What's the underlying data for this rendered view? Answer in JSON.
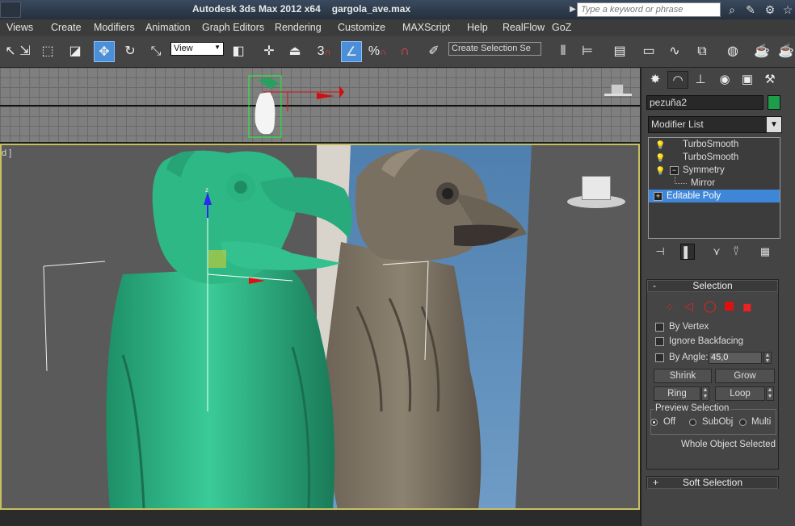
{
  "titlebar": {
    "app_title": "Autodesk 3ds Max  2012 x64",
    "file_name": "gargola_ave.max",
    "search_placeholder": "Type a keyword or phrase"
  },
  "menu": [
    "Views",
    "Create",
    "Modifiers",
    "Animation",
    "Graph Editors",
    "Rendering",
    "Customize",
    "MAXScript",
    "Help",
    "RealFlow",
    "GoZ"
  ],
  "toolbar": {
    "reference_coord": "View",
    "selection_set_placeholder": "Create Selection Se",
    "snap_value": "3",
    "percent_snap": "%"
  },
  "viewport": {
    "label": "d ]"
  },
  "command_panel": {
    "object_name": "pezuña2",
    "object_color": "#1d9c4a",
    "modifier_list_label": "Modifier List",
    "stack": [
      {
        "label": "TurboSmooth",
        "selected": false
      },
      {
        "label": "TurboSmooth",
        "selected": false
      },
      {
        "label": "Symmetry",
        "selected": false
      },
      {
        "label": "Mirror",
        "selected": false
      },
      {
        "label": "Editable Poly",
        "selected": true
      }
    ]
  },
  "selection_rollout": {
    "title": "Selection",
    "collapse_symbol": "-",
    "by_vertex": "By Vertex",
    "ignore_backfacing": "Ignore Backfacing",
    "by_angle": "By Angle:",
    "angle_value": "45,0",
    "shrink": "Shrink",
    "grow": "Grow",
    "ring": "Ring",
    "loop": "Loop",
    "preview_title": "Preview Selection",
    "preview_options": [
      "Off",
      "SubObj",
      "Multi"
    ],
    "preview_selected": "Off",
    "status": "Whole Object Selected"
  },
  "soft_selection_rollout": {
    "title": "Soft Selection",
    "expand_symbol": "+"
  },
  "colors": {
    "accent_blue": "#3e86d8",
    "viewport_border": "#c8c060",
    "model_green": "#2fb888"
  }
}
